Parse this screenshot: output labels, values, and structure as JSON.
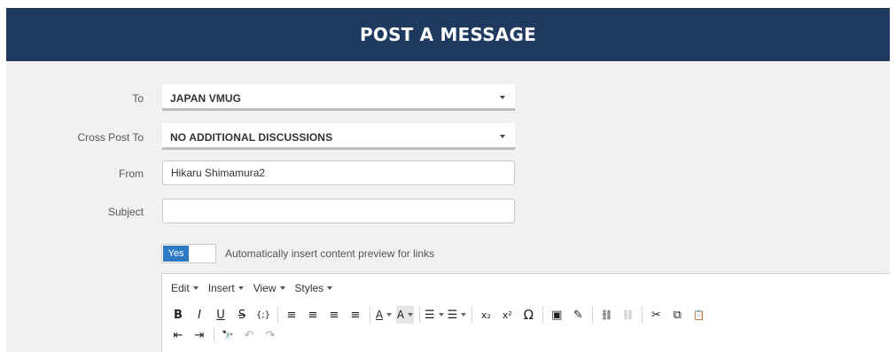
{
  "header": {
    "title": "POST A MESSAGE"
  },
  "form": {
    "to": {
      "label": "To",
      "value": "JAPAN VMUG"
    },
    "cross_post": {
      "label": "Cross Post To",
      "value": "NO ADDITIONAL DISCUSSIONS"
    },
    "from": {
      "label": "From",
      "value": "Hikaru Shimamura2"
    },
    "subject": {
      "label": "Subject",
      "value": ""
    },
    "preview_toggle": {
      "state_label": "Yes",
      "text": "Automatically insert content preview for links"
    }
  },
  "editor": {
    "menus": [
      "Edit",
      "Insert",
      "View",
      "Styles"
    ],
    "toolbar_row1": [
      {
        "name": "bold-icon",
        "glyph": "B"
      },
      {
        "name": "italic-icon",
        "glyph": "I"
      },
      {
        "name": "underline-icon",
        "glyph": "U"
      },
      {
        "name": "strikethrough-icon",
        "glyph": "S"
      },
      {
        "name": "code-icon",
        "glyph": "{;}"
      },
      {
        "name": "align-left-icon",
        "glyph": "≡"
      },
      {
        "name": "align-center-icon",
        "glyph": "≡"
      },
      {
        "name": "align-right-icon",
        "glyph": "≡"
      },
      {
        "name": "align-justify-icon",
        "glyph": "≡"
      },
      {
        "name": "text-color-icon",
        "glyph": "A"
      },
      {
        "name": "background-color-icon",
        "glyph": "A"
      },
      {
        "name": "bullet-list-icon",
        "glyph": "☰"
      },
      {
        "name": "numbered-list-icon",
        "glyph": "☰"
      },
      {
        "name": "subscript-icon",
        "glyph": "x₂"
      },
      {
        "name": "superscript-icon",
        "glyph": "x²"
      },
      {
        "name": "special-character-icon",
        "glyph": "Ω"
      },
      {
        "name": "image-icon",
        "glyph": "▣"
      },
      {
        "name": "edit-image-icon",
        "glyph": "✎"
      },
      {
        "name": "link-icon",
        "glyph": "⛓"
      },
      {
        "name": "unlink-icon",
        "glyph": "⛓"
      },
      {
        "name": "cut-icon",
        "glyph": "✂"
      },
      {
        "name": "copy-icon",
        "glyph": "⧉"
      },
      {
        "name": "paste-icon",
        "glyph": "📋"
      }
    ],
    "toolbar_row2": [
      {
        "name": "outdent-icon",
        "glyph": "⇤"
      },
      {
        "name": "indent-icon",
        "glyph": "⇥"
      },
      {
        "name": "find-icon",
        "glyph": "🔭"
      },
      {
        "name": "undo-icon",
        "glyph": "↶"
      },
      {
        "name": "redo-icon",
        "glyph": "↷"
      }
    ]
  },
  "colors": {
    "header_bg": "#1e3a5f",
    "toggle_on": "#2e79c4"
  }
}
